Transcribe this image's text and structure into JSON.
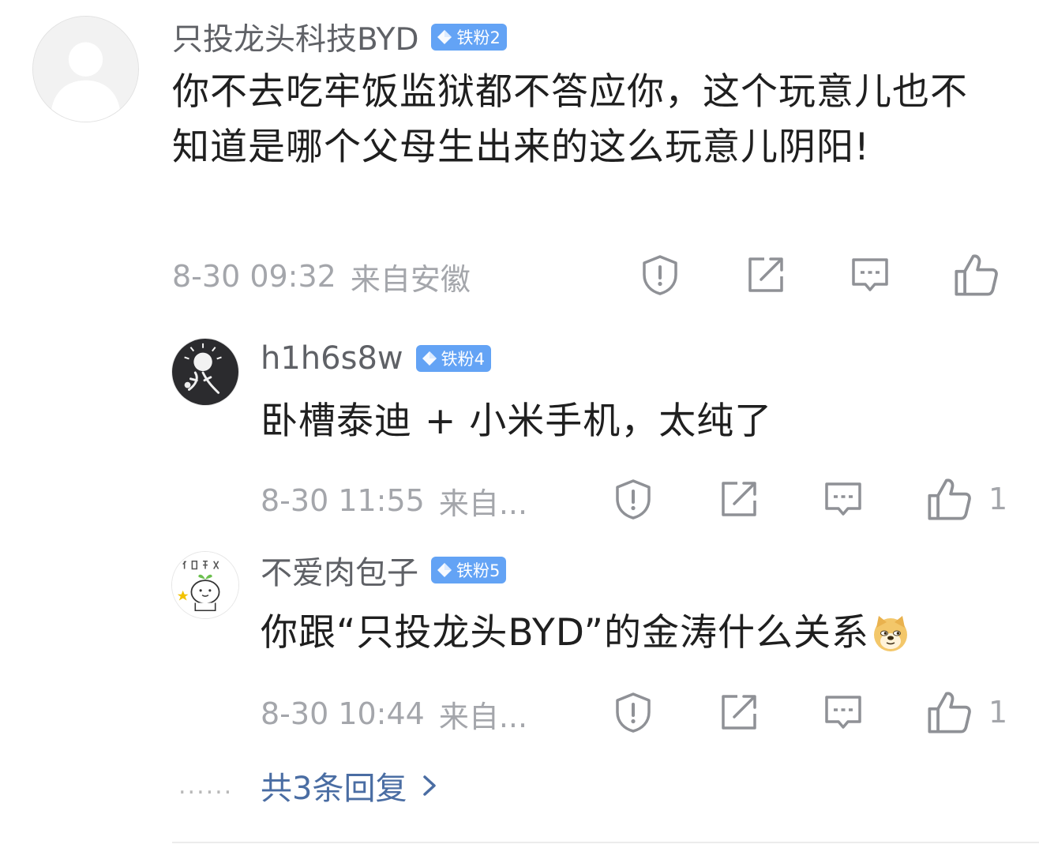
{
  "main_comment": {
    "username": "只投龙头科技BYD",
    "badge": "铁粉2",
    "text": "你不去吃牢饭监狱都不答应你，这个玩意儿也不知道是哪个父母生出来的这么玩意儿阴阳!",
    "time": "8-30 09:32",
    "location": "来自安徽",
    "avatar_icon": "default-avatar-icon"
  },
  "replies": [
    {
      "username": "h1h6s8w",
      "badge": "铁粉4",
      "text": "卧槽泰迪 + 小米手机，太纯了",
      "time": "8-30 11:55",
      "location": "来自...",
      "likes": "1"
    },
    {
      "username": "不爱肉包子",
      "badge": "铁粉5",
      "text": "你跟“只投龙头BYD”的金涛什么关系",
      "emoji": "doge-emoji",
      "time": "8-30 10:44",
      "location": "来自...",
      "likes": "1"
    }
  ],
  "footer": {
    "dots": "......",
    "more_replies": "共3条回复"
  },
  "icons": {
    "report": "report-icon",
    "share": "share-icon",
    "comment": "comment-icon",
    "like": "thumbs-up-icon"
  },
  "colors": {
    "badge_bg": "#63a3f5",
    "link": "#4a6da3",
    "meta_gray": "#a4a6ab",
    "username_gray": "#5f6166"
  }
}
